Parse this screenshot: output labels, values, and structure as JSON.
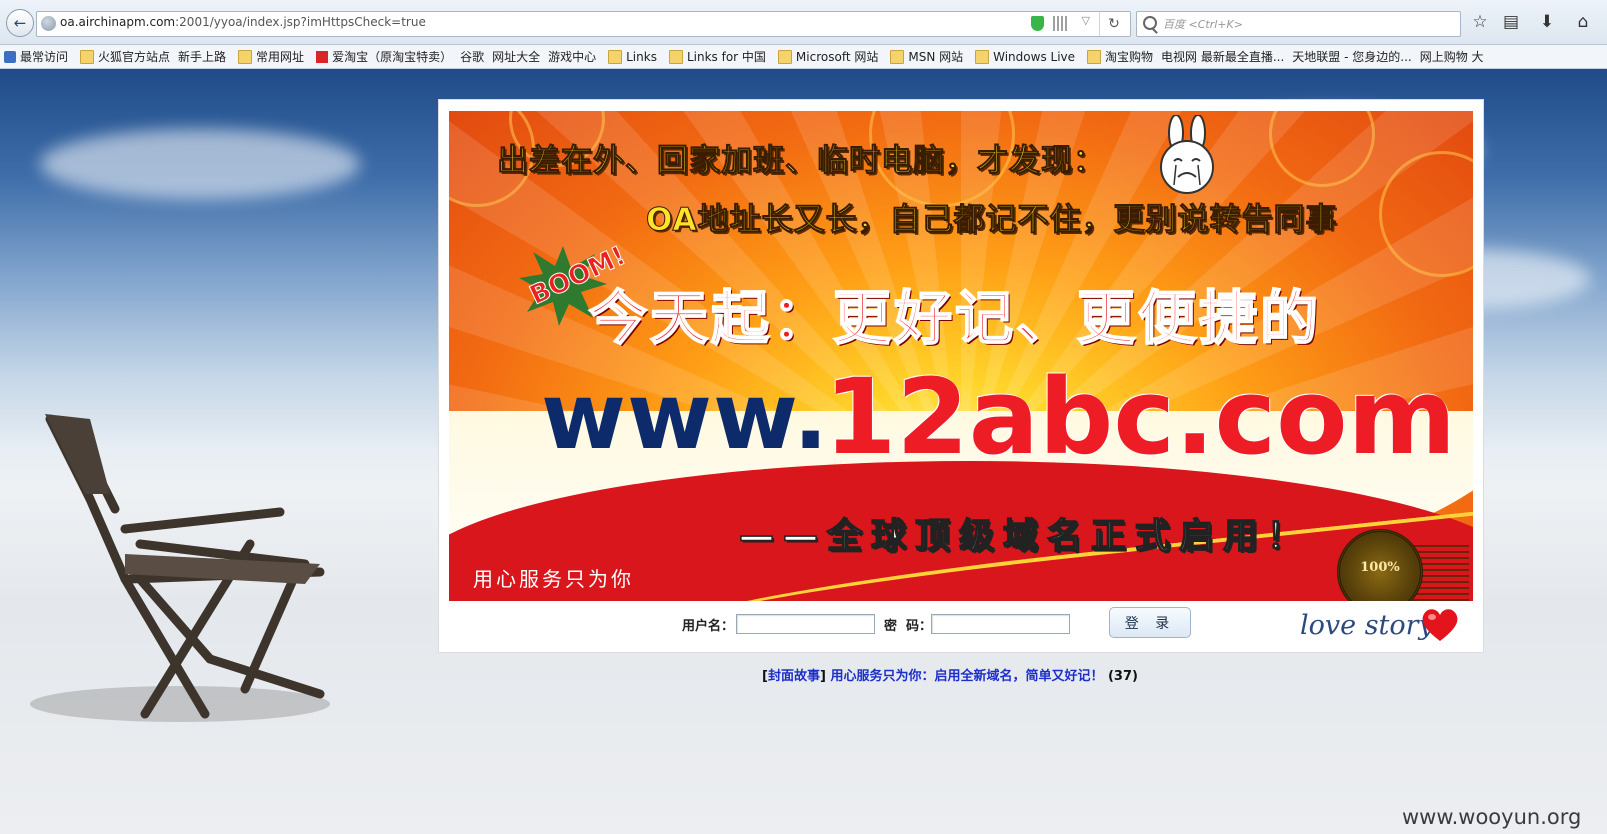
{
  "browser": {
    "url_host": "oa.airchinapm.com",
    "url_rest": ":2001/yyoa/index.jsp?imHttpsCheck=true",
    "url_prefix": "",
    "search_placeholder": "百度 <Ctrl+K>",
    "back_glyph": "←",
    "reload_glyph": "↻",
    "dropdown_glyph": "▽",
    "star_glyph": "☆",
    "reader_glyph": "▤",
    "download_glyph": "⬇",
    "home_glyph": "⌂"
  },
  "bookmarks": [
    {
      "label": "最常访问",
      "icon": "blue"
    },
    {
      "label": "火狐官方站点",
      "icon": "folder"
    },
    {
      "label": "新手上路",
      "icon": "page"
    },
    {
      "label": "常用网址",
      "icon": "folder"
    },
    {
      "label": "爱淘宝（原淘宝特卖）",
      "icon": "red"
    },
    {
      "label": "谷歌",
      "icon": "page"
    },
    {
      "label": "网址大全",
      "icon": "page"
    },
    {
      "label": "游戏中心",
      "icon": "page"
    },
    {
      "label": "Links",
      "icon": "folder"
    },
    {
      "label": "Links for 中国",
      "icon": "folder"
    },
    {
      "label": "Microsoft 网站",
      "icon": "folder"
    },
    {
      "label": "MSN 网站",
      "icon": "folder"
    },
    {
      "label": "Windows Live",
      "icon": "folder"
    },
    {
      "label": "淘宝购物",
      "icon": "folder"
    },
    {
      "label": "电视网 最新最全直播...",
      "icon": "page"
    },
    {
      "label": "天地联盟 - 您身边的...",
      "icon": "page"
    },
    {
      "label": "网上购物 大",
      "icon": "page"
    }
  ],
  "banner": {
    "line1": "出差在外、回家加班、临时电脑，才发现：",
    "line2": "OA地址长又长，自己都记不住，更别说转告同事",
    "line3": "今天起：更好记、更便捷的",
    "boom": "BOOM!",
    "www": "www.",
    "domain": "12abc.com",
    "tagline": "——全球顶级域名正式启用！",
    "service": "用心服务只为你",
    "seal": "100%"
  },
  "login": {
    "username_label": "用户名：",
    "password_label": "密  码：",
    "username_value": "",
    "password_value": "",
    "button_label": "登 录",
    "love_text": "love story"
  },
  "news": {
    "bracket_open": "[",
    "category": "封面故事",
    "bracket_close": "] ",
    "title": "用心服务只为你：启用全新域名，简单又好记！",
    "count": " (37)"
  },
  "watermark": "www.wooyun.org"
}
